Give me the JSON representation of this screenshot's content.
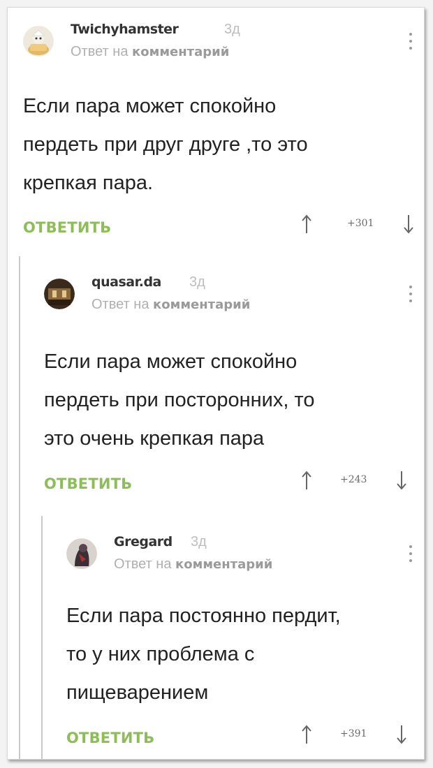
{
  "comments": [
    {
      "username": "Twichyhamster",
      "time": "3д",
      "reply_to_prefix": "Ответ на",
      "reply_to_word": "комментарий",
      "lines": [
        "Если пара может спокойно",
        "пердеть при друг друге ,то это",
        "крепкая пара."
      ],
      "reply_label": "ОТВЕТИТЬ",
      "score": "+301"
    },
    {
      "username": "quasar.da",
      "time": "3д",
      "reply_to_prefix": "Ответ на",
      "reply_to_word": "комментарий",
      "lines": [
        "Если пара может спокойно",
        "пердеть при посторонних, то",
        "это очень крепкая пара"
      ],
      "reply_label": "ОТВЕТИТЬ",
      "score": "+243"
    },
    {
      "username": "Gregard",
      "time": "3д",
      "reply_to_prefix": "Ответ на",
      "reply_to_word": "комментарий",
      "lines": [
        "Если пара постоянно пердит,",
        "то у них проблема с",
        "пищеварением"
      ],
      "reply_label": "ОТВЕТИТЬ",
      "score": "+391"
    }
  ],
  "colors": {
    "reply_green": "#8dbd58",
    "username": "#333333",
    "meta_grey": "#b0b0b0",
    "thread_line": "#c9c9c9"
  },
  "icons": [
    "avatar-hamster",
    "avatar-room",
    "avatar-dark-figure",
    "more-vertical-icon",
    "upvote-arrow-icon",
    "downvote-arrow-icon"
  ]
}
